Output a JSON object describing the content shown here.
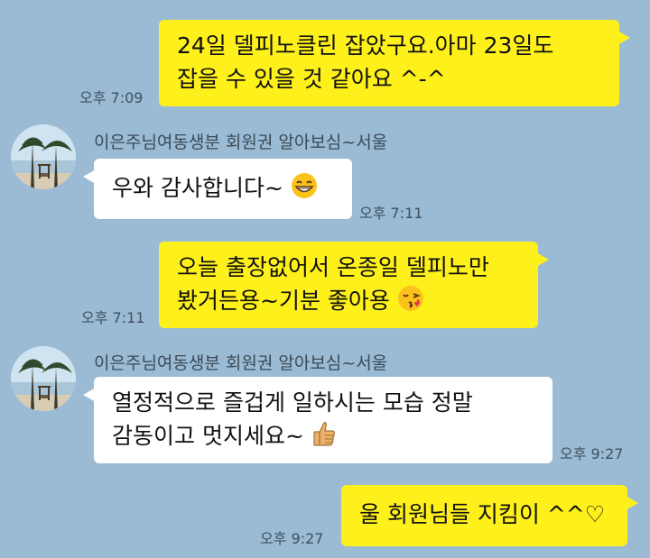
{
  "messages": [
    {
      "side": "mine",
      "lines": [
        "24일 델피노클린 잡았구요.아마 23일도",
        "잡을 수 있을 것 같아요 ^-^"
      ],
      "time": "오후 7:09"
    },
    {
      "side": "theirs",
      "sender": "이은주님여동생분 회원권 알아보심~서울",
      "text": "우와 감사합니다~",
      "emoji": "grinning-face-emoji",
      "time": "오후 7:11"
    },
    {
      "side": "mine",
      "lines": [
        "오늘 출장없어서 온종일 델피노만",
        "봤거든용~기분 좋아용"
      ],
      "emoji": "kissing-face-emoji",
      "time": "오후 7:11"
    },
    {
      "side": "theirs",
      "sender": "이은주님여동생분 회원권 알아보심~서울",
      "lines": [
        "열정적으로 즐겁게 일하시는 모습 정말",
        "감동이고 멋지세요~"
      ],
      "emoji": "thumbs-up-emoji",
      "time": "오후 9:27"
    },
    {
      "side": "mine",
      "text": "울 회원님들 지킴이 ^^♡",
      "time": "오후 9:27"
    }
  ],
  "colors": {
    "background": "#9bbbd4",
    "my_bubble": "#fef01b",
    "their_bubble": "#ffffff"
  }
}
